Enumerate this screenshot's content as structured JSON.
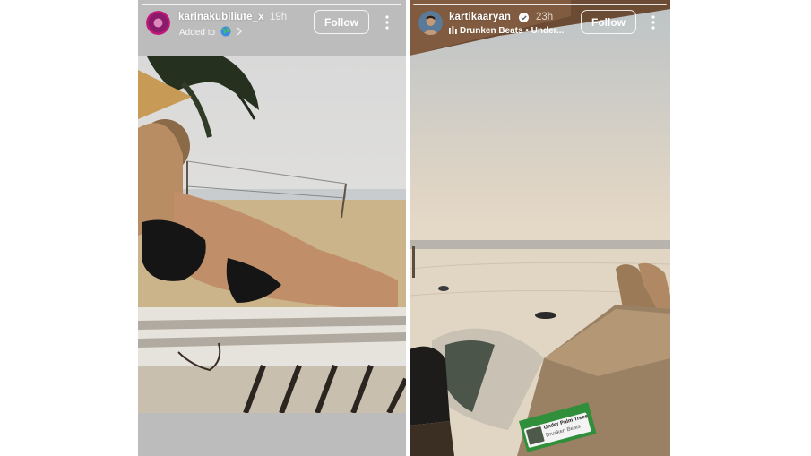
{
  "left_story": {
    "username": "karinakubiliute_x",
    "time": "19h",
    "subtitle": "Added to",
    "follow_label": "Follow"
  },
  "right_story": {
    "username": "kartikaaryan",
    "time": "23h",
    "music_title": "Drunken Beats • Under...",
    "follow_label": "Follow",
    "music_sticker": {
      "title": "Under Palm Trees",
      "artist": "Drunken Beats"
    }
  },
  "colors": {
    "follow_border": "#ffffff",
    "verified_badge": "#ffffff",
    "sticker_green": "#2f8f3a"
  }
}
